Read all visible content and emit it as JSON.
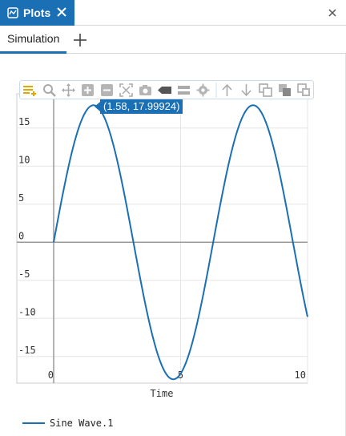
{
  "window": {
    "tab_title": "Plots",
    "tab_icon": "plot-window-icon",
    "close_icon": "close-icon"
  },
  "subtabs": {
    "active_label": "Simulation",
    "add_icon": "plus-icon"
  },
  "toolbar": {
    "buttons": [
      "legend-menu-icon",
      "zoom-icon",
      "pan-icon",
      "zoom-in-icon",
      "zoom-out-icon",
      "fit-icon",
      "camera-icon",
      "label-tag-icon",
      "line-style-icon",
      "settings-icon",
      "arrow-up-icon",
      "arrow-down-icon",
      "copy-icon",
      "duplicate-icon",
      "paste-icon"
    ]
  },
  "tooltip": {
    "text": "(1.58, 17.99924)"
  },
  "colors": {
    "accent": "#1a6fb5",
    "toolbar_highlight": "#e0a800",
    "grid": "#e6e6e6",
    "axis": "#999999"
  },
  "chart_data": {
    "type": "line",
    "title": "",
    "xlabel": "Time",
    "ylabel": "",
    "xlim": [
      0,
      10
    ],
    "ylim": [
      -18.5,
      19.5
    ],
    "x_ticks": [
      0,
      5,
      10
    ],
    "y_ticks": [
      15,
      10,
      5,
      0,
      -5,
      -10,
      -15
    ],
    "grid": true,
    "legend_position": "bottom-left",
    "series": [
      {
        "name": "Sine Wave.1",
        "function": "18*sin(x)",
        "x_start": 0,
        "x_end": 10,
        "color": "#1a6fb5"
      }
    ]
  }
}
